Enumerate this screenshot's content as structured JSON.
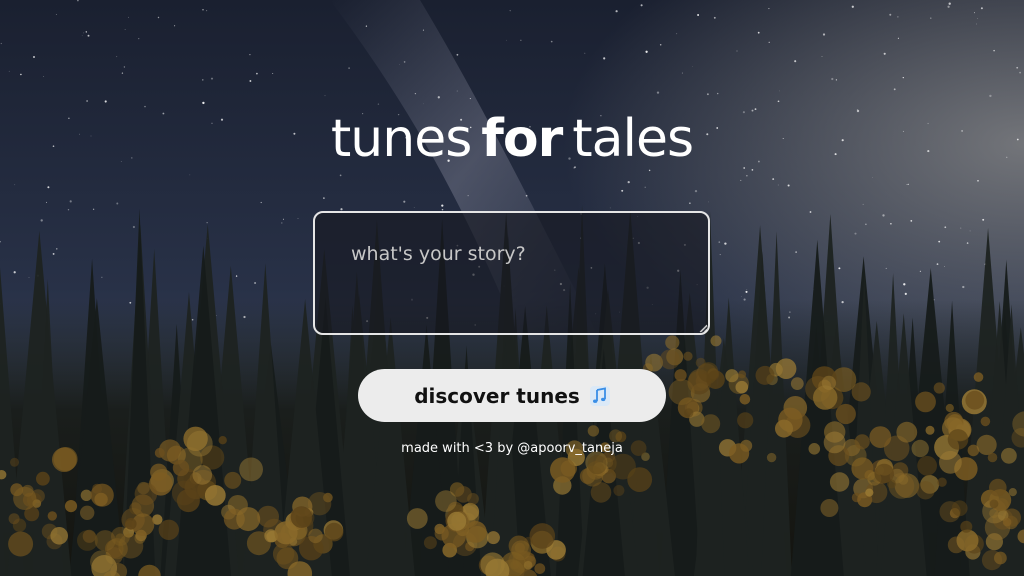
{
  "title": {
    "part1": "tunes",
    "part2": "for",
    "part3": "tales"
  },
  "story_input": {
    "placeholder": "what's your story?",
    "value": ""
  },
  "discover_button": {
    "label": "discover tunes",
    "icon": "music-notes-icon"
  },
  "footer": {
    "text": "made with <3 by @apoorv_taneja"
  },
  "background": {
    "description_colors": {
      "sky_top": "#1a2030",
      "sky_mid": "#2a3348",
      "forest_dark": "#1a1f1c",
      "autumn_leaves": "#8a6a2a",
      "moon_glow": "#9a9a9a"
    }
  },
  "colors": {
    "text": "#ffffff",
    "button_bg": "#ececec",
    "button_text": "#111111",
    "input_border": "#e6e6e6",
    "icon_blue": "#3a8ee6"
  }
}
